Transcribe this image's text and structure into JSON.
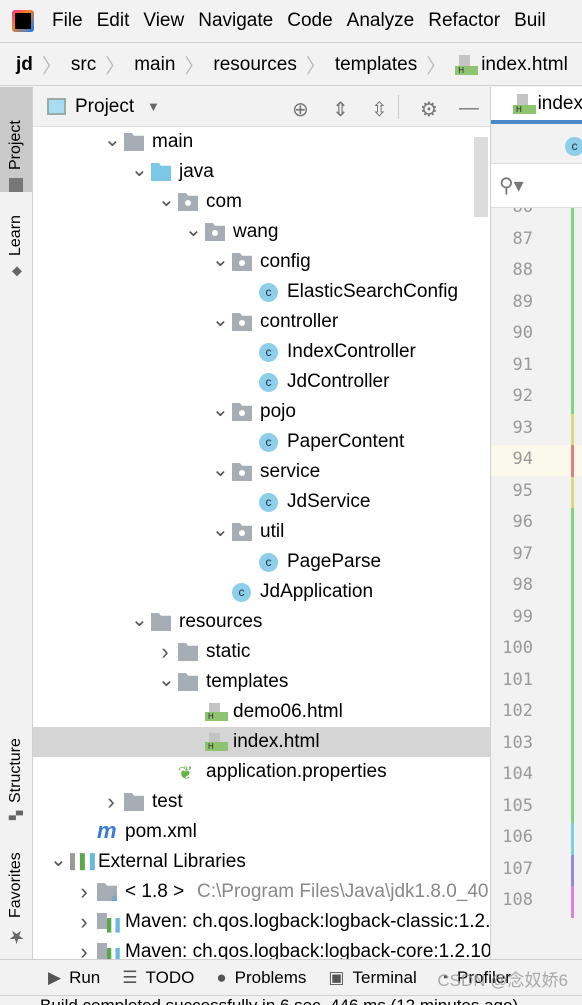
{
  "menubar": {
    "items": [
      "File",
      "Edit",
      "View",
      "Navigate",
      "Code",
      "Analyze",
      "Refactor",
      "Buil"
    ]
  },
  "breadcrumb": [
    "jd",
    "src",
    "main",
    "resources",
    "templates",
    "index.html"
  ],
  "leftbar": {
    "project": "Project",
    "learn": "Learn",
    "structure": "Structure",
    "favorites": "Favorites"
  },
  "panel": {
    "title": "Project"
  },
  "tree": [
    {
      "level": 2,
      "arrow": "down",
      "icon": "folder",
      "label": "main"
    },
    {
      "level": 3,
      "arrow": "down",
      "icon": "folder-blue",
      "label": "java"
    },
    {
      "level": 4,
      "arrow": "down",
      "icon": "package",
      "label": "com"
    },
    {
      "level": 5,
      "arrow": "down",
      "icon": "package",
      "label": "wang"
    },
    {
      "level": 6,
      "arrow": "down",
      "icon": "package",
      "label": "config"
    },
    {
      "level": 7,
      "arrow": "",
      "icon": "class",
      "label": "ElasticSearchConfig"
    },
    {
      "level": 6,
      "arrow": "down",
      "icon": "package",
      "label": "controller"
    },
    {
      "level": 7,
      "arrow": "",
      "icon": "class",
      "label": "IndexController"
    },
    {
      "level": 7,
      "arrow": "",
      "icon": "class",
      "label": "JdController"
    },
    {
      "level": 6,
      "arrow": "down",
      "icon": "package",
      "label": "pojo"
    },
    {
      "level": 7,
      "arrow": "",
      "icon": "class",
      "label": "PaperContent"
    },
    {
      "level": 6,
      "arrow": "down",
      "icon": "package",
      "label": "service"
    },
    {
      "level": 7,
      "arrow": "",
      "icon": "class",
      "label": "JdService"
    },
    {
      "level": 6,
      "arrow": "down",
      "icon": "package",
      "label": "util"
    },
    {
      "level": 7,
      "arrow": "",
      "icon": "class",
      "label": "PageParse"
    },
    {
      "level": 6,
      "arrow": "",
      "icon": "spring-class",
      "label": "JdApplication"
    },
    {
      "level": 3,
      "arrow": "down",
      "icon": "folder-resources",
      "label": "resources"
    },
    {
      "level": 4,
      "arrow": "right",
      "icon": "folder",
      "label": "static"
    },
    {
      "level": 4,
      "arrow": "down",
      "icon": "folder",
      "label": "templates"
    },
    {
      "level": 5,
      "arrow": "",
      "icon": "html",
      "label": "demo06.html"
    },
    {
      "level": 5,
      "arrow": "",
      "icon": "html",
      "label": "index.html",
      "selected": true
    },
    {
      "level": 4,
      "arrow": "",
      "icon": "properties",
      "label": "application.properties"
    },
    {
      "level": 2,
      "arrow": "right",
      "icon": "folder",
      "label": "test"
    },
    {
      "level": 1,
      "arrow": "",
      "icon": "maven",
      "label": "pom.xml"
    },
    {
      "level": 0,
      "arrow": "down",
      "icon": "libraries",
      "label": "External Libraries"
    },
    {
      "level": 1,
      "arrow": "right",
      "icon": "jdk",
      "label": "< 1.8 >",
      "extra": "C:\\Program Files\\Java\\jdk1.8.0_40"
    },
    {
      "level": 1,
      "arrow": "right",
      "icon": "library",
      "label": "Maven: ch.qos.logback:logback-classic:1.2."
    },
    {
      "level": 1,
      "arrow": "right",
      "icon": "library",
      "label": "Maven: ch.qos.logback:logback-core:1.2.10"
    }
  ],
  "editor": {
    "tab": "index",
    "class_badge": "c",
    "line_numbers": [
      "86",
      "87",
      "88",
      "89",
      "90",
      "91",
      "92",
      "93",
      "94",
      "95",
      "96",
      "97",
      "98",
      "99",
      "100",
      "101",
      "102",
      "103",
      "104",
      "105",
      "106",
      "107",
      "108"
    ],
    "change_markers": [
      "#7fd67f",
      "#7fd67f",
      "#7fd67f",
      "#7fd67f",
      "#7fd67f",
      "#7fd67f",
      "#7fd67f",
      "#e0d77c",
      "#e08080",
      "#e0d77c",
      "#7fd67f",
      "#7fd67f",
      "#7fd67f",
      "#7fd67f",
      "#7fd67f",
      "#7fd67f",
      "#7fd67f",
      "#7fd67f",
      "#7fd67f",
      "#7fd67f",
      "#7ad3dc",
      "#8c8ce0",
      "#df82df"
    ]
  },
  "bottombar": {
    "run": "Run",
    "todo": "TODO",
    "problems": "Problems",
    "terminal": "Terminal",
    "profiler": "Profiler"
  },
  "status": "Build completed successfully in 6 sec, 446 ms (12 minutes ago)",
  "watermark": "CSDN @念奴娇6"
}
